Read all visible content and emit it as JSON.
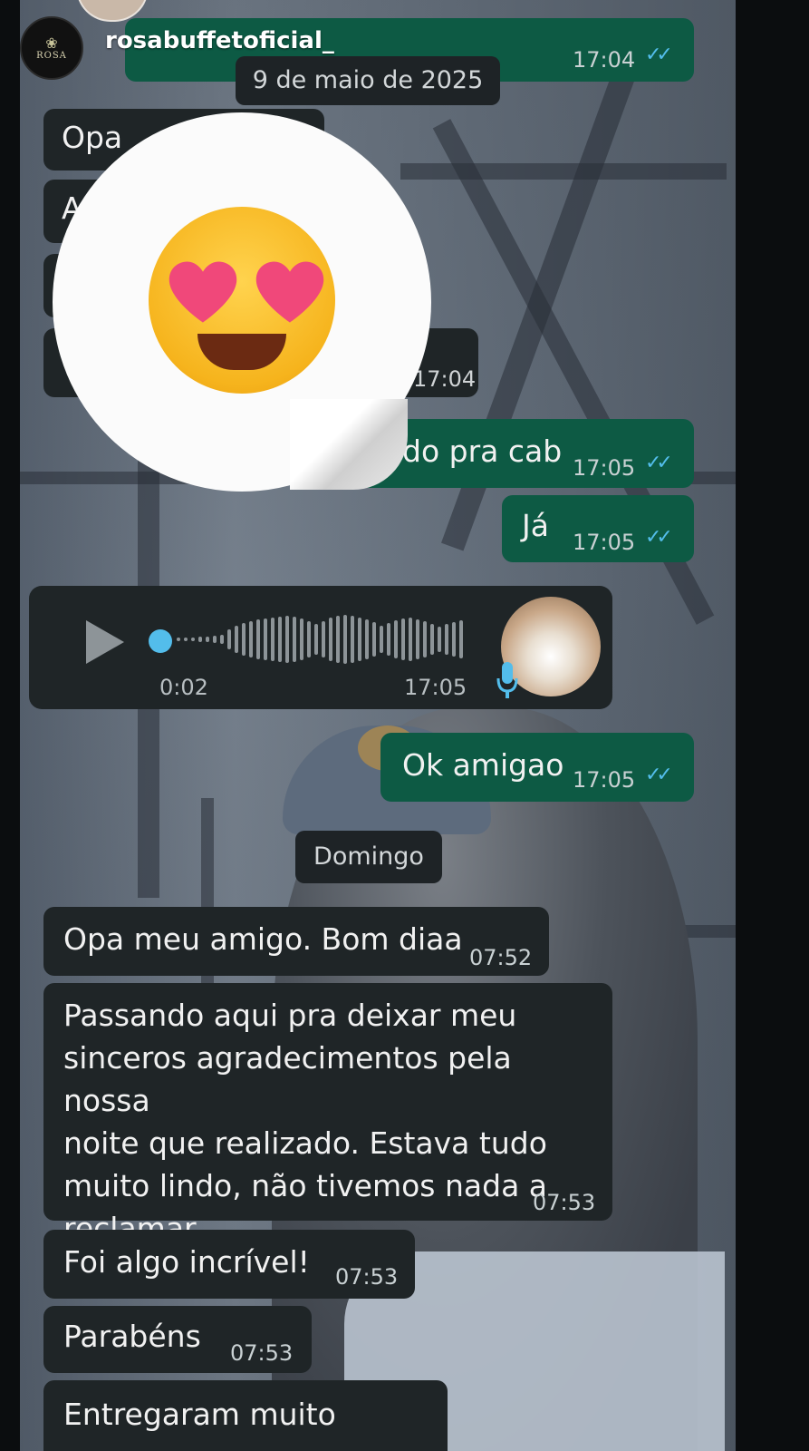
{
  "header": {
    "username": "rosabuffetoficial_",
    "avatar_brand": "ROSA"
  },
  "date_separators": {
    "first": "9 de maio de 2025",
    "second": "Domingo"
  },
  "messages": {
    "top_out_time": "17:04",
    "opa_partial": "Opa",
    "partial_a": "A",
    "partial_time": "17:04",
    "cab_text": "do pra cab",
    "cab_time": "17:05",
    "ja_text": "Já",
    "ja_time": "17:05",
    "voice_duration": "0:02",
    "voice_time": "17:05",
    "ok_text": "Ok amigao",
    "ok_time": "17:05",
    "opa_text": "Opa meu amigo. Bom diaa",
    "opa_time": "07:52",
    "long_lines": [
      "Passando aqui pra deixar meu",
      "sinceros agradecimentos pela nossa",
      "noite que realizado. Estava tudo",
      "muito lindo, não tivemos nada a",
      "reclamar"
    ],
    "long_time": "07:53",
    "foi_text": "Foi algo incrível!",
    "foi_time": "07:53",
    "parabens_text": "Parabéns",
    "parabens_time": "07:53",
    "entregaram_text": "Entregaram muito"
  },
  "sticker": {
    "icon": "heart-eyes-emoji-icon"
  },
  "colors": {
    "incoming_bubble": "#1f2527",
    "outgoing_bubble": "#0d5a44",
    "read_ticks": "#53bdeb"
  }
}
